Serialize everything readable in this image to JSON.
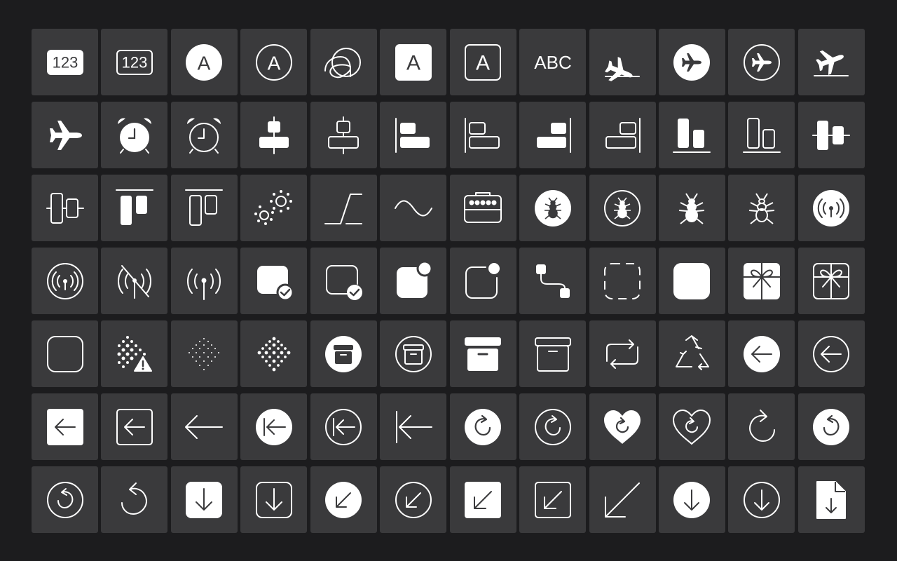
{
  "icon_grid": {
    "columns": 12,
    "icons": [
      "number-square-fill-icon",
      "number-square-icon",
      "a-circle-fill-icon",
      "a-circle-icon",
      "character-icon",
      "a-square-fill-icon",
      "a-square-icon",
      "textformat-abc-icon",
      "airplane-arrival-icon",
      "airplane-circle-fill-icon",
      "airplane-circle-icon",
      "airplane-departure-icon",
      "airplane-icon",
      "alarm-fill-icon",
      "alarm-icon",
      "align-horizontal-center-fill-icon",
      "align-horizontal-center-icon",
      "align-horizontal-left-fill-icon",
      "align-horizontal-left-icon",
      "align-horizontal-right-fill-icon",
      "align-horizontal-right-icon",
      "align-vertical-bottom-fill-icon",
      "align-vertical-bottom-icon",
      "align-vertical-center-fill-icon",
      "align-vertical-center-icon",
      "align-vertical-top-fill-icon",
      "align-vertical-top-icon",
      "circle-grid-cross-icon",
      "angle-icon",
      "wave-icon",
      "amplifier-icon",
      "ant-circle-fill-icon",
      "ant-circle-icon",
      "ant-fill-icon",
      "ant-icon",
      "antenna-radiowaves-circle-fill-icon",
      "antenna-radiowaves-circle-icon",
      "antenna-radiowaves-slash-icon",
      "antenna-radiowaves-icon",
      "app-badge-checkmark-fill-icon",
      "app-badge-checkmark-icon",
      "app-badge-fill-icon",
      "app-badge-icon",
      "app-connected-icon",
      "app-dashed-icon",
      "app-fill-icon",
      "app-gift-fill-icon",
      "app-gift-icon",
      "app-icon",
      "aqi-high-icon",
      "aqi-low-icon",
      "aqi-medium-icon",
      "archivebox-circle-fill-icon",
      "archivebox-circle-icon",
      "archivebox-fill-icon",
      "archivebox-icon",
      "arrow-2-squarepath-icon",
      "arrow-3-trianglepath-icon",
      "arrow-backward-circle-fill-icon",
      "arrow-backward-circle-icon",
      "arrow-backward-square-fill-icon",
      "arrow-backward-square-icon",
      "arrow-backward-icon",
      "arrow-backward-to-line-circle-fill-icon",
      "arrow-backward-to-line-circle-icon",
      "arrow-backward-to-line-icon",
      "arrow-clockwise-circle-fill-icon",
      "arrow-clockwise-circle-icon",
      "arrow-clockwise-heart-fill-icon",
      "arrow-clockwise-heart-icon",
      "arrow-clockwise-icon",
      "arrow-counterclockwise-circle-fill-icon",
      "arrow-counterclockwise-circle-icon",
      "arrow-counterclockwise-icon",
      "arrow-down-app-fill-icon",
      "arrow-down-app-icon",
      "arrow-down-left-circle-fill-icon",
      "arrow-down-left-circle-icon",
      "arrow-down-left-square-fill-icon",
      "arrow-down-left-square-icon",
      "arrow-down-left-icon",
      "arrow-down-circle-fill-icon",
      "arrow-down-circle-icon",
      "arrow-down-doc-fill-icon"
    ],
    "text": {
      "n123": "123",
      "a": "A",
      "abc": "ABC"
    }
  }
}
